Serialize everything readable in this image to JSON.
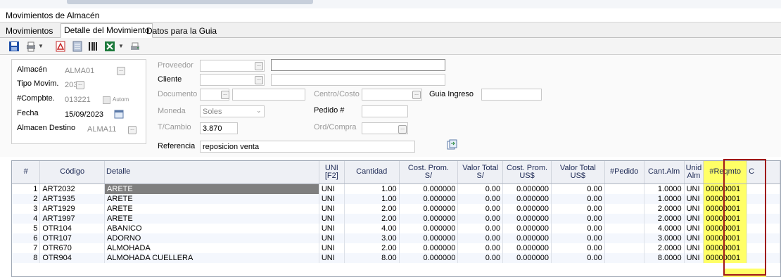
{
  "window": {
    "title": "Movimientos de Almacén"
  },
  "tabs": [
    {
      "label": "Movimientos"
    },
    {
      "label": "Detalle del Movimiento",
      "active": true
    },
    {
      "label": "Datos para la Guia"
    }
  ],
  "toolbar": {
    "icons": [
      "save-icon",
      "print-icon",
      "pdf-icon",
      "notes-icon",
      "barcode-icon",
      "excel-icon",
      "printer-setup-icon"
    ]
  },
  "form": {
    "almacen": {
      "label": "Almacén",
      "value": "ALMA01"
    },
    "tipo_movim": {
      "label": "Tipo Movim.",
      "value": "203"
    },
    "compbte": {
      "label": "#Compbte.",
      "value": "013221",
      "autom_label": "Autom"
    },
    "fecha": {
      "label": "Fecha",
      "value": "15/09/2023"
    },
    "almacen_destino": {
      "label": "Almacen Destino",
      "value": "ALMA11"
    },
    "proveedor": {
      "label": "Proveedor",
      "value": ""
    },
    "cliente": {
      "label": "Cliente",
      "value": ""
    },
    "documento": {
      "label": "Documento",
      "value": ""
    },
    "moneda": {
      "label": "Moneda",
      "value": "Soles"
    },
    "tcambio": {
      "label": "T/Cambio",
      "value": "3.870"
    },
    "referencia": {
      "label": "Referencia",
      "value": "reposicion venta"
    },
    "centro_costo": {
      "label": "Centro/Costo",
      "value": ""
    },
    "guia_ingreso": {
      "label": "Guia Ingreso",
      "value": ""
    },
    "pedido": {
      "label": "Pedido #",
      "value": ""
    },
    "ord_compra": {
      "label": "Ord/Compra",
      "value": ""
    }
  },
  "grid": {
    "headers": {
      "num": "#",
      "codigo": "Código",
      "detalle": "Detalle",
      "uni_1": "UNI",
      "uni_2": "[F2]",
      "cantidad": "Cantidad",
      "cost_prom_s_1": "Cost. Prom.",
      "cost_prom_s_2": "S/",
      "valor_total_s_1": "Valor Total",
      "valor_total_s_2": "S/",
      "cost_prom_us_1": "Cost. Prom.",
      "cost_prom_us_2": "US$",
      "valor_total_us_1": "Valor Total",
      "valor_total_us_2": "US$",
      "pedido": "#Pedido",
      "cant_alm": "Cant.Alm",
      "unid_alm_1": "Unid",
      "unid_alm_2": "Alm",
      "reqmto": "#Reqmto",
      "extra": "C"
    },
    "rows": [
      {
        "num": "1",
        "codigo": "ART2032",
        "detalle": "ARETE",
        "uni": "UNI",
        "cantidad": "1.00",
        "cost_s": "0.000000",
        "valor_s": "0.00",
        "cost_us": "0.000000",
        "valor_us": "0.00",
        "pedido": "",
        "cant_alm": "1.0000",
        "unid_alm": "UNI",
        "reqmto": "00000001"
      },
      {
        "num": "2",
        "codigo": "ART1935",
        "detalle": "ARETE",
        "uni": "UNI",
        "cantidad": "1.00",
        "cost_s": "0.000000",
        "valor_s": "0.00",
        "cost_us": "0.000000",
        "valor_us": "0.00",
        "pedido": "",
        "cant_alm": "1.0000",
        "unid_alm": "UNI",
        "reqmto": "00000001"
      },
      {
        "num": "3",
        "codigo": "ART1929",
        "detalle": "ARETE",
        "uni": "UNI",
        "cantidad": "2.00",
        "cost_s": "0.000000",
        "valor_s": "0.00",
        "cost_us": "0.000000",
        "valor_us": "0.00",
        "pedido": "",
        "cant_alm": "2.0000",
        "unid_alm": "UNI",
        "reqmto": "00000001"
      },
      {
        "num": "4",
        "codigo": "ART1997",
        "detalle": "ARETE",
        "uni": "UNI",
        "cantidad": "2.00",
        "cost_s": "0.000000",
        "valor_s": "0.00",
        "cost_us": "0.000000",
        "valor_us": "0.00",
        "pedido": "",
        "cant_alm": "2.0000",
        "unid_alm": "UNI",
        "reqmto": "00000001"
      },
      {
        "num": "5",
        "codigo": "OTR104",
        "detalle": "ABANICO",
        "uni": "UNI",
        "cantidad": "4.00",
        "cost_s": "0.000000",
        "valor_s": "0.00",
        "cost_us": "0.000000",
        "valor_us": "0.00",
        "pedido": "",
        "cant_alm": "4.0000",
        "unid_alm": "UNI",
        "reqmto": "00000001"
      },
      {
        "num": "6",
        "codigo": "OTR107",
        "detalle": "ADORNO",
        "uni": "UNI",
        "cantidad": "3.00",
        "cost_s": "0.000000",
        "valor_s": "0.00",
        "cost_us": "0.000000",
        "valor_us": "0.00",
        "pedido": "",
        "cant_alm": "3.0000",
        "unid_alm": "UNI",
        "reqmto": "00000001"
      },
      {
        "num": "7",
        "codigo": "OTR670",
        "detalle": "ALMOHADA",
        "uni": "UNI",
        "cantidad": "2.00",
        "cost_s": "0.000000",
        "valor_s": "0.00",
        "cost_us": "0.000000",
        "valor_us": "0.00",
        "pedido": "",
        "cant_alm": "2.0000",
        "unid_alm": "UNI",
        "reqmto": "00000001"
      },
      {
        "num": "8",
        "codigo": "OTR904",
        "detalle": "ALMOHADA CUELLERA",
        "uni": "UNI",
        "cantidad": "8.00",
        "cost_s": "0.000000",
        "valor_s": "0.00",
        "cost_us": "0.000000",
        "valor_us": "0.00",
        "pedido": "",
        "cant_alm": "8.0000",
        "unid_alm": "UNI",
        "reqmto": "00000001"
      }
    ]
  },
  "colors": {
    "highlight_border": "#a01818",
    "highlight_fill": "#ffff66",
    "selected_cell": "#7f7f7f",
    "header_text": "#1e2a55"
  }
}
